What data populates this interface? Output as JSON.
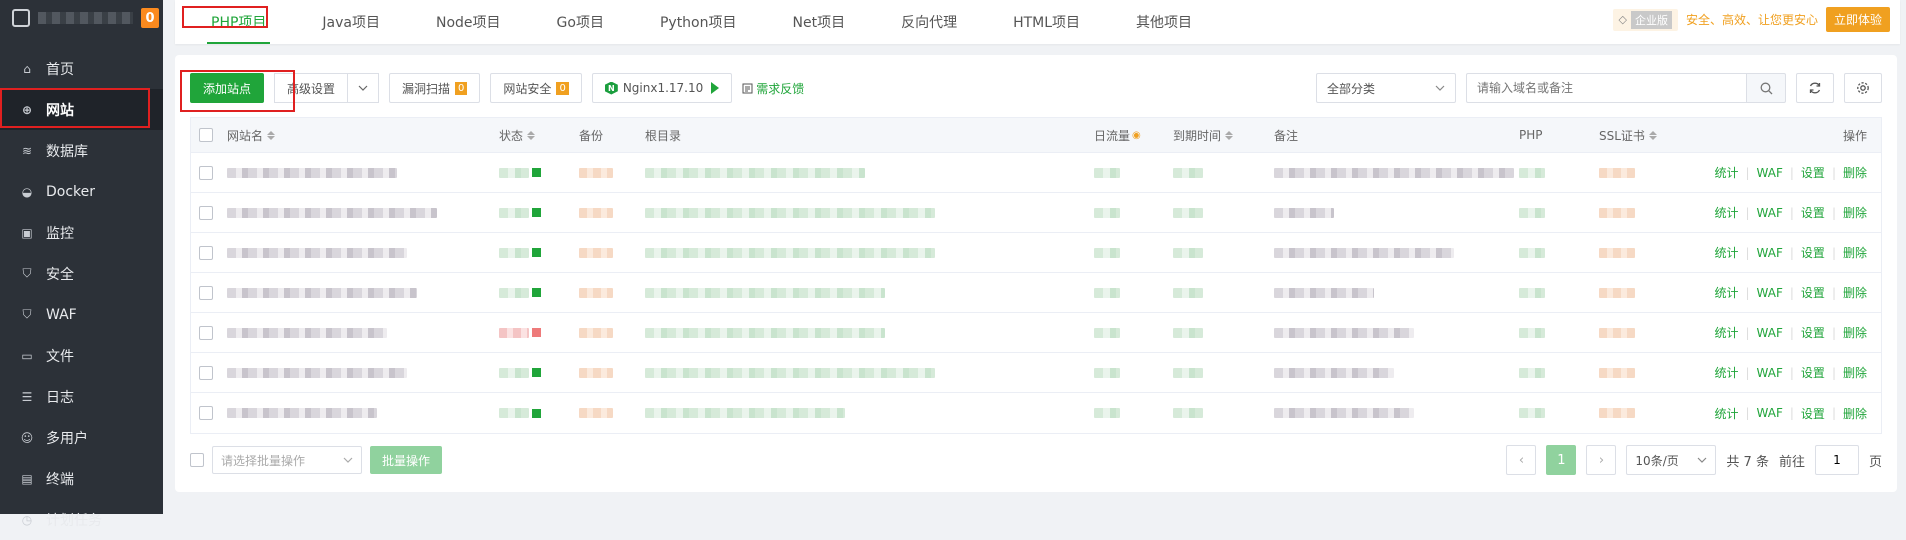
{
  "sidebar": {
    "badge": "0",
    "items": [
      {
        "label": "首页",
        "icon": "home-icon"
      },
      {
        "label": "网站",
        "icon": "globe-icon"
      },
      {
        "label": "数据库",
        "icon": "database-icon"
      },
      {
        "label": "Docker",
        "icon": "docker-icon"
      },
      {
        "label": "监控",
        "icon": "monitor-icon"
      },
      {
        "label": "安全",
        "icon": "shield-icon"
      },
      {
        "label": "WAF",
        "icon": "waf-shield-icon"
      },
      {
        "label": "文件",
        "icon": "folder-icon"
      },
      {
        "label": "日志",
        "icon": "log-icon"
      },
      {
        "label": "多用户",
        "icon": "users-icon"
      },
      {
        "label": "终端",
        "icon": "terminal-icon"
      },
      {
        "label": "计划任务",
        "icon": "clock-icon"
      }
    ]
  },
  "tabs": [
    "PHP项目",
    "Java项目",
    "Node项目",
    "Go项目",
    "Python项目",
    "Net项目",
    "反向代理",
    "HTML项目",
    "其他项目"
  ],
  "promo": {
    "tag": "企业版",
    "text": "安全、高效、让您更安心",
    "button": "立即体验"
  },
  "toolbar": {
    "add_site": "添加站点",
    "advanced": "高级设置",
    "vuln_scan": "漏洞扫描",
    "vuln_count": "0",
    "site_security": "网站安全",
    "security_count": "0",
    "nginx": "Nginx1.17.10",
    "feedback": "需求反馈",
    "category": "全部分类",
    "search_placeholder": "请输入域名或备注"
  },
  "table": {
    "headers": {
      "name": "网站名",
      "status": "状态",
      "backup": "备份",
      "root": "根目录",
      "traffic": "日流量",
      "expire": "到期时间",
      "remark": "备注",
      "php": "PHP",
      "ssl": "SSL证书",
      "ops": "操作"
    },
    "row_ops": [
      "统计",
      "WAF",
      "设置",
      "删除"
    ],
    "rows": [
      {
        "status": "running"
      },
      {
        "status": "running"
      },
      {
        "status": "running"
      },
      {
        "status": "running"
      },
      {
        "status": "stopped"
      },
      {
        "status": "running"
      },
      {
        "status": "running"
      }
    ]
  },
  "footer": {
    "batch_placeholder": "请选择批量操作",
    "batch_button": "批量操作",
    "current_page": "1",
    "page_size": "10条/页",
    "total": "共 7 条",
    "goto_prefix": "前往",
    "goto_value": "1",
    "goto_suffix": "页"
  }
}
